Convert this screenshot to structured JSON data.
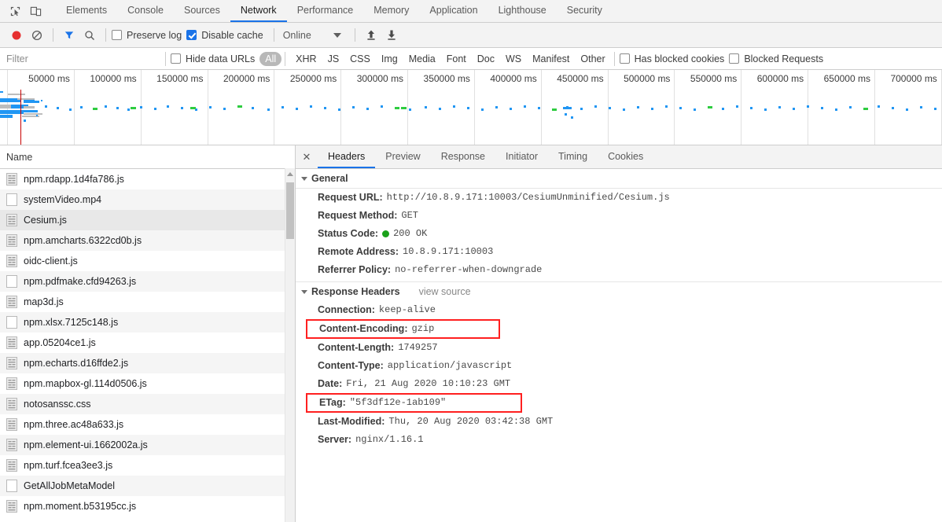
{
  "top_bar": {
    "icons": [
      {
        "name": "inspect-element-icon",
        "label": "Inspect element"
      },
      {
        "name": "device-toolbar-icon",
        "label": "Toggle device toolbar"
      }
    ],
    "tabs": [
      {
        "label": "Elements",
        "selected": false
      },
      {
        "label": "Console",
        "selected": false
      },
      {
        "label": "Sources",
        "selected": false
      },
      {
        "label": "Network",
        "selected": true
      },
      {
        "label": "Performance",
        "selected": false
      },
      {
        "label": "Memory",
        "selected": false
      },
      {
        "label": "Application",
        "selected": false
      },
      {
        "label": "Lighthouse",
        "selected": false
      },
      {
        "label": "Security",
        "selected": false
      }
    ]
  },
  "control_bar": {
    "record_icon": "record-button-icon",
    "clear_icon": "clear-icon",
    "filter_icon": "filter-funnel-icon",
    "search_icon": "search-icon",
    "preserve_log": {
      "label": "Preserve log",
      "checked": false
    },
    "disable_cache": {
      "label": "Disable cache",
      "checked": true
    },
    "throttling": "Online",
    "import_icon": "import-har-icon",
    "export_icon": "export-har-icon"
  },
  "filter_bar": {
    "filter_placeholder": "Filter",
    "filter_value": "",
    "hide_data_urls": {
      "label": "Hide data URLs",
      "checked": false
    },
    "types": [
      {
        "label": "All",
        "selected": true
      },
      {
        "label": "XHR",
        "selected": false
      },
      {
        "label": "JS",
        "selected": false
      },
      {
        "label": "CSS",
        "selected": false
      },
      {
        "label": "Img",
        "selected": false
      },
      {
        "label": "Media",
        "selected": false
      },
      {
        "label": "Font",
        "selected": false
      },
      {
        "label": "Doc",
        "selected": false
      },
      {
        "label": "WS",
        "selected": false
      },
      {
        "label": "Manifest",
        "selected": false
      },
      {
        "label": "Other",
        "selected": false
      }
    ],
    "has_blocked_cookies": {
      "label": "Has blocked cookies",
      "checked": false
    },
    "blocked_requests": {
      "label": "Blocked Requests",
      "checked": false
    }
  },
  "overview": {
    "ticks": [
      "50000 ms",
      "100000 ms",
      "150000 ms",
      "200000 ms",
      "250000 ms",
      "300000 ms",
      "350000 ms",
      "400000 ms",
      "450000 ms",
      "500000 ms",
      "550000 ms",
      "600000 ms",
      "650000 ms",
      "700000 ms"
    ],
    "marker_color": "#c80000",
    "bar_colors": {
      "blue": "#2196f3",
      "gray": "#bdbdbd",
      "green": "#2ecc40"
    }
  },
  "request_list": {
    "column_header": "Name",
    "rows": [
      {
        "name": "npm.rdapp.1d4fa786.js",
        "type": "script",
        "selected": false
      },
      {
        "name": "systemVideo.mp4",
        "type": "media",
        "selected": false
      },
      {
        "name": "Cesium.js",
        "type": "script",
        "selected": true
      },
      {
        "name": "npm.amcharts.6322cd0b.js",
        "type": "script",
        "selected": false
      },
      {
        "name": "oidc-client.js",
        "type": "script",
        "selected": false
      },
      {
        "name": "npm.pdfmake.cfd94263.js",
        "type": "other",
        "selected": false
      },
      {
        "name": "map3d.js",
        "type": "script",
        "selected": false
      },
      {
        "name": "npm.xlsx.7125c148.js",
        "type": "other",
        "selected": false
      },
      {
        "name": "app.05204ce1.js",
        "type": "script",
        "selected": false
      },
      {
        "name": "npm.echarts.d16ffde2.js",
        "type": "script",
        "selected": false
      },
      {
        "name": "npm.mapbox-gl.114d0506.js",
        "type": "script",
        "selected": false
      },
      {
        "name": "notosanssc.css",
        "type": "script",
        "selected": false
      },
      {
        "name": "npm.three.ac48a633.js",
        "type": "script",
        "selected": false
      },
      {
        "name": "npm.element-ui.1662002a.js",
        "type": "script",
        "selected": false
      },
      {
        "name": "npm.turf.fcea3ee3.js",
        "type": "script",
        "selected": false
      },
      {
        "name": "GetAllJobMetaModel",
        "type": "other",
        "selected": false
      },
      {
        "name": "npm.moment.b53195cc.js",
        "type": "script",
        "selected": false
      }
    ]
  },
  "detail": {
    "close_label": "✕",
    "tabs": [
      {
        "label": "Headers",
        "selected": true
      },
      {
        "label": "Preview",
        "selected": false
      },
      {
        "label": "Response",
        "selected": false
      },
      {
        "label": "Initiator",
        "selected": false
      },
      {
        "label": "Timing",
        "selected": false
      },
      {
        "label": "Cookies",
        "selected": false
      }
    ],
    "general": {
      "title": "General",
      "rows": [
        {
          "key": "Request URL:",
          "value": "http://10.8.9.171:10003/CesiumUnminified/Cesium.js",
          "highlighted": false
        },
        {
          "key": "Request Method:",
          "value": "GET",
          "highlighted": false
        },
        {
          "key": "Status Code:",
          "value": "200 OK",
          "status_dot": true,
          "highlighted": false
        },
        {
          "key": "Remote Address:",
          "value": "10.8.9.171:10003",
          "highlighted": false
        },
        {
          "key": "Referrer Policy:",
          "value": "no-referrer-when-downgrade",
          "highlighted": false
        }
      ]
    },
    "response_headers": {
      "title": "Response Headers",
      "view_source": "view source",
      "rows": [
        {
          "key": "Connection:",
          "value": "keep-alive",
          "highlighted": false
        },
        {
          "key": "Content-Encoding:",
          "value": "gzip",
          "highlighted": true
        },
        {
          "key": "Content-Length:",
          "value": "1749257",
          "highlighted": false
        },
        {
          "key": "Content-Type:",
          "value": "application/javascript",
          "highlighted": false
        },
        {
          "key": "Date:",
          "value": "Fri, 21 Aug 2020 10:10:23 GMT",
          "highlighted": false
        },
        {
          "key": "ETag:",
          "value": "\"5f3df12e-1ab109\"",
          "highlighted": true
        },
        {
          "key": "Last-Modified:",
          "value": "Thu, 20 Aug 2020 03:42:38 GMT",
          "highlighted": false
        },
        {
          "key": "Server:",
          "value": "nginx/1.16.1",
          "highlighted": false
        }
      ]
    }
  }
}
